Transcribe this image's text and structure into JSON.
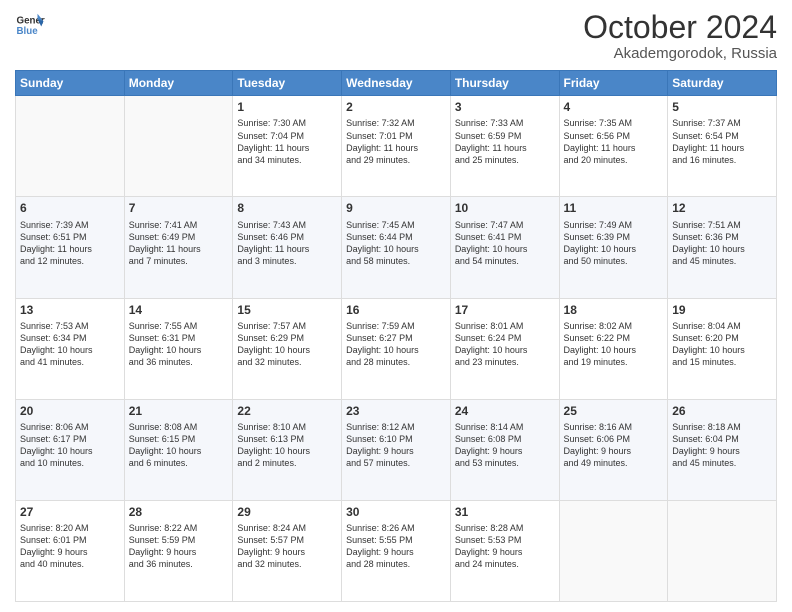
{
  "logo": {
    "line1": "General",
    "line2": "Blue"
  },
  "title": "October 2024",
  "subtitle": "Akademgorodok, Russia",
  "weekdays": [
    "Sunday",
    "Monday",
    "Tuesday",
    "Wednesday",
    "Thursday",
    "Friday",
    "Saturday"
  ],
  "weeks": [
    [
      {
        "day": "",
        "sunrise": "",
        "sunset": "",
        "daylight": ""
      },
      {
        "day": "",
        "sunrise": "",
        "sunset": "",
        "daylight": ""
      },
      {
        "day": "1",
        "sunrise": "Sunrise: 7:30 AM",
        "sunset": "Sunset: 7:04 PM",
        "daylight": "Daylight: 11 hours and 34 minutes."
      },
      {
        "day": "2",
        "sunrise": "Sunrise: 7:32 AM",
        "sunset": "Sunset: 7:01 PM",
        "daylight": "Daylight: 11 hours and 29 minutes."
      },
      {
        "day": "3",
        "sunrise": "Sunrise: 7:33 AM",
        "sunset": "Sunset: 6:59 PM",
        "daylight": "Daylight: 11 hours and 25 minutes."
      },
      {
        "day": "4",
        "sunrise": "Sunrise: 7:35 AM",
        "sunset": "Sunset: 6:56 PM",
        "daylight": "Daylight: 11 hours and 20 minutes."
      },
      {
        "day": "5",
        "sunrise": "Sunrise: 7:37 AM",
        "sunset": "Sunset: 6:54 PM",
        "daylight": "Daylight: 11 hours and 16 minutes."
      }
    ],
    [
      {
        "day": "6",
        "sunrise": "Sunrise: 7:39 AM",
        "sunset": "Sunset: 6:51 PM",
        "daylight": "Daylight: 11 hours and 12 minutes."
      },
      {
        "day": "7",
        "sunrise": "Sunrise: 7:41 AM",
        "sunset": "Sunset: 6:49 PM",
        "daylight": "Daylight: 11 hours and 7 minutes."
      },
      {
        "day": "8",
        "sunrise": "Sunrise: 7:43 AM",
        "sunset": "Sunset: 6:46 PM",
        "daylight": "Daylight: 11 hours and 3 minutes."
      },
      {
        "day": "9",
        "sunrise": "Sunrise: 7:45 AM",
        "sunset": "Sunset: 6:44 PM",
        "daylight": "Daylight: 10 hours and 58 minutes."
      },
      {
        "day": "10",
        "sunrise": "Sunrise: 7:47 AM",
        "sunset": "Sunset: 6:41 PM",
        "daylight": "Daylight: 10 hours and 54 minutes."
      },
      {
        "day": "11",
        "sunrise": "Sunrise: 7:49 AM",
        "sunset": "Sunset: 6:39 PM",
        "daylight": "Daylight: 10 hours and 50 minutes."
      },
      {
        "day": "12",
        "sunrise": "Sunrise: 7:51 AM",
        "sunset": "Sunset: 6:36 PM",
        "daylight": "Daylight: 10 hours and 45 minutes."
      }
    ],
    [
      {
        "day": "13",
        "sunrise": "Sunrise: 7:53 AM",
        "sunset": "Sunset: 6:34 PM",
        "daylight": "Daylight: 10 hours and 41 minutes."
      },
      {
        "day": "14",
        "sunrise": "Sunrise: 7:55 AM",
        "sunset": "Sunset: 6:31 PM",
        "daylight": "Daylight: 10 hours and 36 minutes."
      },
      {
        "day": "15",
        "sunrise": "Sunrise: 7:57 AM",
        "sunset": "Sunset: 6:29 PM",
        "daylight": "Daylight: 10 hours and 32 minutes."
      },
      {
        "day": "16",
        "sunrise": "Sunrise: 7:59 AM",
        "sunset": "Sunset: 6:27 PM",
        "daylight": "Daylight: 10 hours and 28 minutes."
      },
      {
        "day": "17",
        "sunrise": "Sunrise: 8:01 AM",
        "sunset": "Sunset: 6:24 PM",
        "daylight": "Daylight: 10 hours and 23 minutes."
      },
      {
        "day": "18",
        "sunrise": "Sunrise: 8:02 AM",
        "sunset": "Sunset: 6:22 PM",
        "daylight": "Daylight: 10 hours and 19 minutes."
      },
      {
        "day": "19",
        "sunrise": "Sunrise: 8:04 AM",
        "sunset": "Sunset: 6:20 PM",
        "daylight": "Daylight: 10 hours and 15 minutes."
      }
    ],
    [
      {
        "day": "20",
        "sunrise": "Sunrise: 8:06 AM",
        "sunset": "Sunset: 6:17 PM",
        "daylight": "Daylight: 10 hours and 10 minutes."
      },
      {
        "day": "21",
        "sunrise": "Sunrise: 8:08 AM",
        "sunset": "Sunset: 6:15 PM",
        "daylight": "Daylight: 10 hours and 6 minutes."
      },
      {
        "day": "22",
        "sunrise": "Sunrise: 8:10 AM",
        "sunset": "Sunset: 6:13 PM",
        "daylight": "Daylight: 10 hours and 2 minutes."
      },
      {
        "day": "23",
        "sunrise": "Sunrise: 8:12 AM",
        "sunset": "Sunset: 6:10 PM",
        "daylight": "Daylight: 9 hours and 57 minutes."
      },
      {
        "day": "24",
        "sunrise": "Sunrise: 8:14 AM",
        "sunset": "Sunset: 6:08 PM",
        "daylight": "Daylight: 9 hours and 53 minutes."
      },
      {
        "day": "25",
        "sunrise": "Sunrise: 8:16 AM",
        "sunset": "Sunset: 6:06 PM",
        "daylight": "Daylight: 9 hours and 49 minutes."
      },
      {
        "day": "26",
        "sunrise": "Sunrise: 8:18 AM",
        "sunset": "Sunset: 6:04 PM",
        "daylight": "Daylight: 9 hours and 45 minutes."
      }
    ],
    [
      {
        "day": "27",
        "sunrise": "Sunrise: 8:20 AM",
        "sunset": "Sunset: 6:01 PM",
        "daylight": "Daylight: 9 hours and 40 minutes."
      },
      {
        "day": "28",
        "sunrise": "Sunrise: 8:22 AM",
        "sunset": "Sunset: 5:59 PM",
        "daylight": "Daylight: 9 hours and 36 minutes."
      },
      {
        "day": "29",
        "sunrise": "Sunrise: 8:24 AM",
        "sunset": "Sunset: 5:57 PM",
        "daylight": "Daylight: 9 hours and 32 minutes."
      },
      {
        "day": "30",
        "sunrise": "Sunrise: 8:26 AM",
        "sunset": "Sunset: 5:55 PM",
        "daylight": "Daylight: 9 hours and 28 minutes."
      },
      {
        "day": "31",
        "sunrise": "Sunrise: 8:28 AM",
        "sunset": "Sunset: 5:53 PM",
        "daylight": "Daylight: 9 hours and 24 minutes."
      },
      {
        "day": "",
        "sunrise": "",
        "sunset": "",
        "daylight": ""
      },
      {
        "day": "",
        "sunrise": "",
        "sunset": "",
        "daylight": ""
      }
    ]
  ]
}
